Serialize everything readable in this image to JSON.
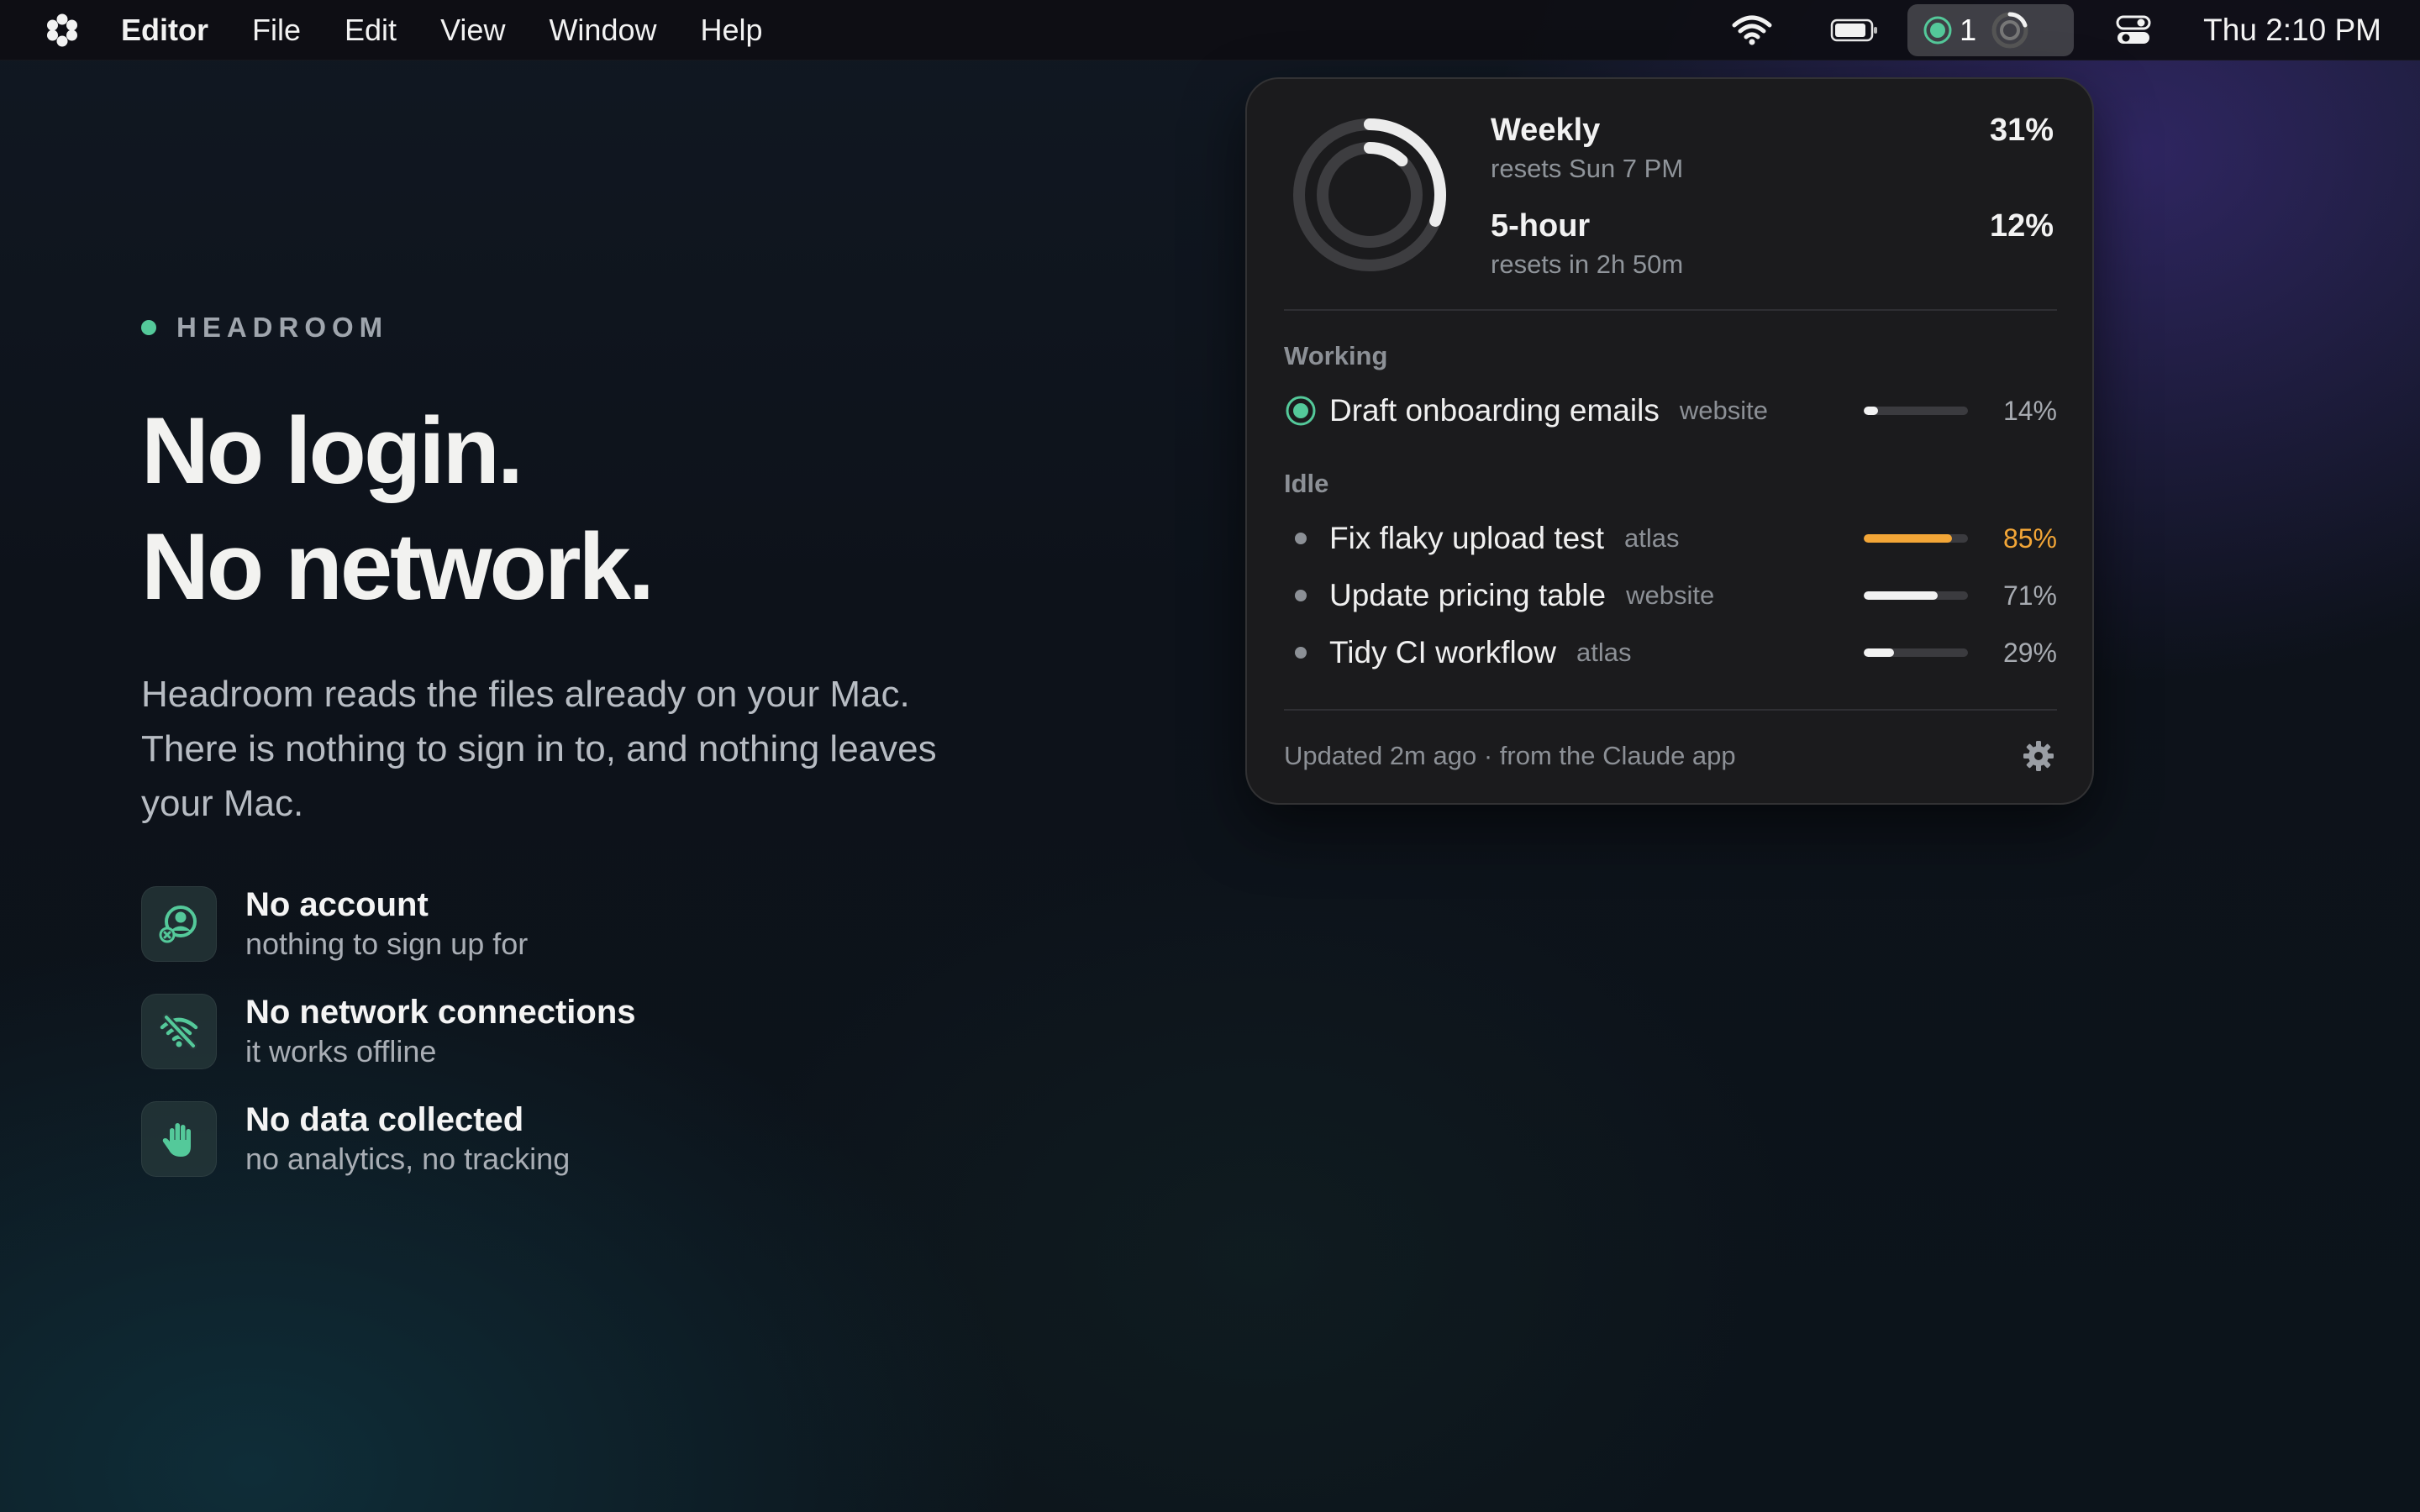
{
  "menubar": {
    "app_name": "Editor",
    "menus": [
      "File",
      "Edit",
      "View",
      "Window",
      "Help"
    ],
    "status_count": "1",
    "clock": "Thu 2:10 PM",
    "icons": [
      "flower-logo-icon",
      "wifi-icon",
      "battery-icon",
      "headroom-status-icon",
      "control-center-icon"
    ]
  },
  "hero": {
    "eyebrow": "HEADROOM",
    "headline_line1": "No login.",
    "headline_line2": "No network.",
    "lede": "Headroom reads the files already on your Mac. There is nothing to sign in to, and nothing leaves your Mac.",
    "features": [
      {
        "title": "No account",
        "subtitle": "nothing to sign up for",
        "icon": "no-account-icon"
      },
      {
        "title": "No network connections",
        "subtitle": "it works offline",
        "icon": "no-wifi-icon"
      },
      {
        "title": "No data collected",
        "subtitle": "no analytics, no tracking",
        "icon": "hand-stop-icon"
      }
    ],
    "accent": "#54c99a"
  },
  "popover": {
    "limits": [
      {
        "label": "Weekly",
        "reset": "resets Sun 7 PM",
        "percent": "31%",
        "value": 31
      },
      {
        "label": "5-hour",
        "reset": "resets in 2h 50m",
        "percent": "12%",
        "value": 12
      }
    ],
    "working_label": "Working",
    "idle_label": "Idle",
    "working_tasks": [
      {
        "name": "Draft onboarding emails",
        "project": "website",
        "percent": "14%",
        "value": 14
      }
    ],
    "idle_tasks": [
      {
        "name": "Fix flaky upload test",
        "project": "atlas",
        "percent": "85%",
        "value": 85
      },
      {
        "name": "Update pricing table",
        "project": "website",
        "percent": "71%",
        "value": 71
      },
      {
        "name": "Tidy CI workflow",
        "project": "atlas",
        "percent": "29%",
        "value": 29
      }
    ],
    "footer": "Updated 2m ago · from the Claude app",
    "colors": {
      "warn": "#f3a637",
      "active": "#54c99a",
      "bar": "#f2f2f2",
      "track": "#3b3b3f"
    }
  }
}
